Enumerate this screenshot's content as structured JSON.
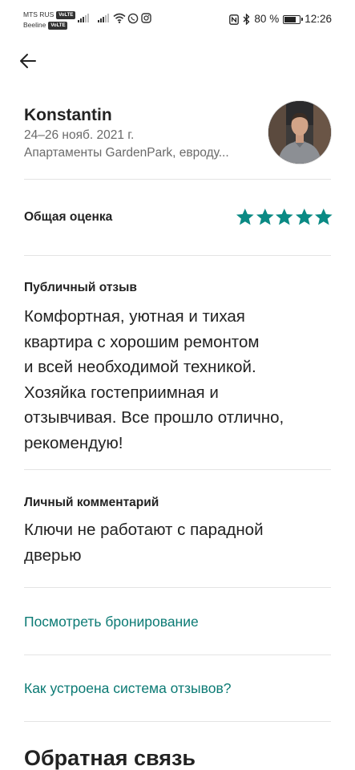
{
  "status_bar": {
    "carrier_1": "MTS RUS",
    "carrier_2": "Beeline",
    "volte_badge": "VoLTE",
    "battery_percent": "80 %",
    "battery_level": 0.8,
    "time": "12:26"
  },
  "review": {
    "guest_name": "Konstantin",
    "dates": "24–26 нояб. 2021 г.",
    "listing": "Апартаменты GardenPark, евроду...",
    "overall_label": "Общая оценка",
    "rating": 5,
    "rating_max": 5,
    "public_label": "Публичный отзыв",
    "public_lines": [
      "Комфортная, уютная и тихая",
      "квартира с хорошим ремонтом",
      "и всей необходимой техникой.",
      "Хозяйка гостеприимная и",
      "отзывчивая. Все прошло отлично,",
      "рекомендую!"
    ],
    "private_label": "Личный комментарий",
    "private_lines": [
      "Ключи не работают с парадной",
      "дверью"
    ]
  },
  "links": {
    "view_booking": "Посмотреть бронирование",
    "how_reviews_work": "Как устроена система отзывов?"
  },
  "feedback": {
    "title": "Обратная связь"
  },
  "colors": {
    "accent_teal": "#0b7a74",
    "star_teal": "#0a8a84",
    "text_primary": "#222222",
    "text_secondary": "#6a6a6a"
  }
}
